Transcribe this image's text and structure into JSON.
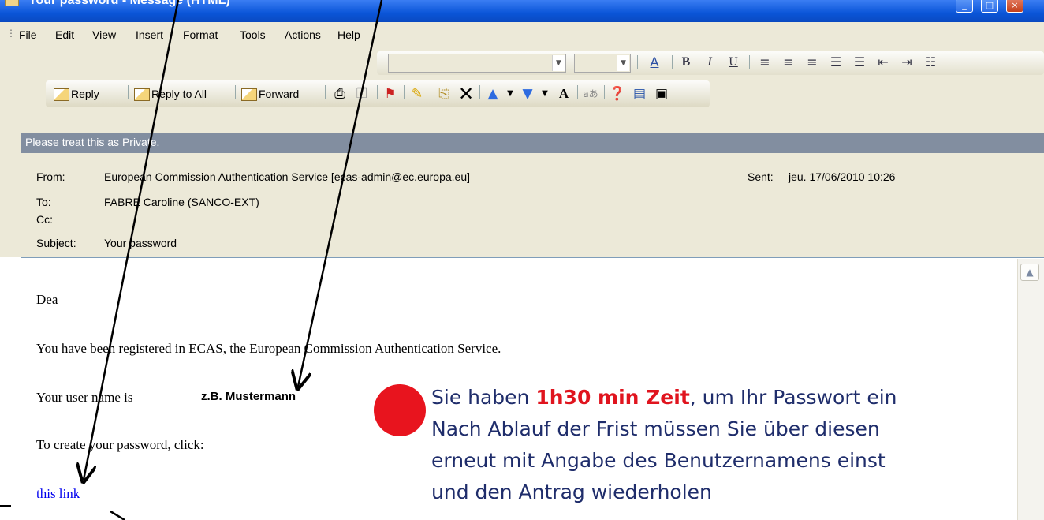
{
  "window": {
    "title": "Your password - Message (HTML)"
  },
  "menu": [
    "File",
    "Edit",
    "View",
    "Insert",
    "Format",
    "Tools",
    "Actions",
    "Help"
  ],
  "toolbar": {
    "reply": "Reply",
    "reply_all": "Reply to All",
    "forward": "Forward"
  },
  "infobar": {
    "text": "Please treat this as Private."
  },
  "headers": {
    "from_label": "From:",
    "from_value": "European Commission Authentication Service [ecas-admin@ec.europa.eu]",
    "sent_label": "Sent:",
    "sent_value": "jeu. 17/06/2010 10:26",
    "to_label": "To:",
    "to_value": "FABRE Caroline (SANCO-EXT)",
    "cc_label": "Cc:",
    "subject_label": "Subject:",
    "subject_value": "Your password"
  },
  "body": {
    "greeting": "Dea",
    "line1": "You have been registered in ECAS, the European Commission Authentication Service.",
    "user_label": "Your user name is",
    "user_value": "z.B. Mustermann",
    "create": "To create your password, click:",
    "link": "this link"
  },
  "note": {
    "line1_a": "Sie haben ",
    "line1_highlight": "1h30 min Zeit",
    "line1_b": ", um Ihr Passwort ein",
    "line2": "Nach Ablauf der Frist müssen Sie über diesen",
    "line3": "erneut mit Angabe des Benutzernamens einst",
    "line4": "und den Antrag wiederholen"
  },
  "colors": {
    "highlight": "#e0141e",
    "info_bar": "#828ea0",
    "link": "#0000ee"
  }
}
